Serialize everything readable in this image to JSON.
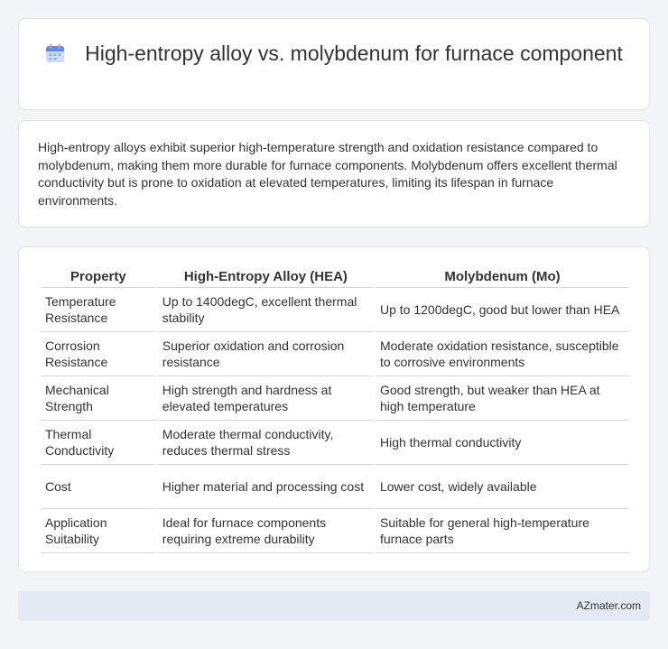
{
  "header": {
    "title": "High-entropy alloy vs. molybdenum for furnace component",
    "icon": "calendar-icon"
  },
  "summary": {
    "text": "High-entropy alloys exhibit superior high-temperature strength and oxidation resistance compared to molybdenum, making them more durable for furnace components. Molybdenum offers excellent thermal conductivity but is prone to oxidation at elevated temperatures, limiting its lifespan in furnace environments."
  },
  "table": {
    "headers": [
      "Property",
      "High-Entropy Alloy (HEA)",
      "Molybdenum (Mo)"
    ],
    "rows": [
      [
        "Temperature Resistance",
        "Up to 1400degC, excellent thermal stability",
        "Up to 1200degC, good but lower than HEA"
      ],
      [
        "Corrosion Resistance",
        "Superior oxidation and corrosion resistance",
        "Moderate oxidation resistance, susceptible to corrosive environments"
      ],
      [
        "Mechanical Strength",
        "High strength and hardness at elevated temperatures",
        "Good strength, but weaker than HEA at high temperature"
      ],
      [
        "Thermal Conductivity",
        "Moderate thermal conductivity, reduces thermal stress",
        "High thermal conductivity"
      ],
      [
        "Cost",
        "Higher material and processing cost",
        "Lower cost, widely available"
      ],
      [
        "Application Suitability",
        "Ideal for furnace components requiring extreme durability",
        "Suitable for general high-temperature furnace parts"
      ]
    ]
  },
  "footer": {
    "text": "AZmater.com"
  },
  "colors": {
    "page_bg": "#f3f4f6",
    "card_bg": "#ffffff",
    "footer_bg": "#e4e9f4",
    "text": "#333333",
    "icon_blue": "#5b8def",
    "icon_pink": "#e889b5"
  }
}
